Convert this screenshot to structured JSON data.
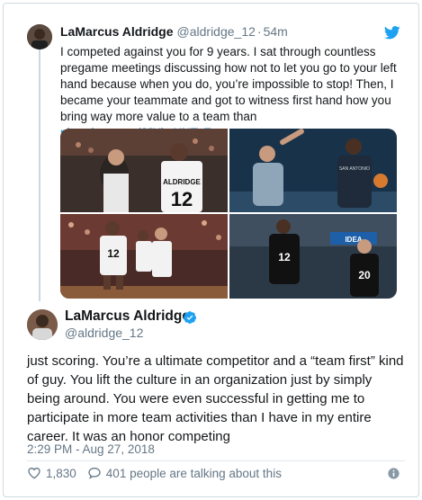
{
  "quoted_tweet": {
    "display_name": "LaMarcus Aldridge",
    "handle": "@aldridge_12",
    "separator": "·",
    "time": "54m",
    "text": "I competed against you for 9 years. I sat through countless pregame meetings discussing how not to let you go to your left hand because when you do, you’re impossible to stop! Then, I became your teammate and got to witness first hand how you bring way more value to a team than",
    "link": "pic.twitter.com/JJYbvXNToE"
  },
  "main_tweet": {
    "display_name": "LaMarcus Aldridge",
    "handle": "@aldridge_12",
    "text": "just scoring. You’re a ultimate competitor and a “team first” kind of guy. You lift the culture in an organization just by simply being around. You were even successful in getting me to participate in more team activities than I have in my entire career. It was an honor competing",
    "timestamp": "2:29 PM - Aug 27, 2018",
    "like_count": "1,830",
    "talking_text": "401 people are talking about this"
  },
  "media": {
    "jersey_numbers": [
      "12",
      "12",
      "12",
      "20"
    ],
    "jersey_text": "ALDRIDGE",
    "banner_text": "IDEA"
  },
  "colors": {
    "twitter_blue": "#1da1f2",
    "link_blue": "#1b95e0",
    "text": "#14171a",
    "secondary": "#657786",
    "border": "#cfd9de"
  },
  "icons": [
    "twitter-bird-icon",
    "verified-badge-icon",
    "heart-icon",
    "reply-bubble-icon",
    "info-icon"
  ]
}
